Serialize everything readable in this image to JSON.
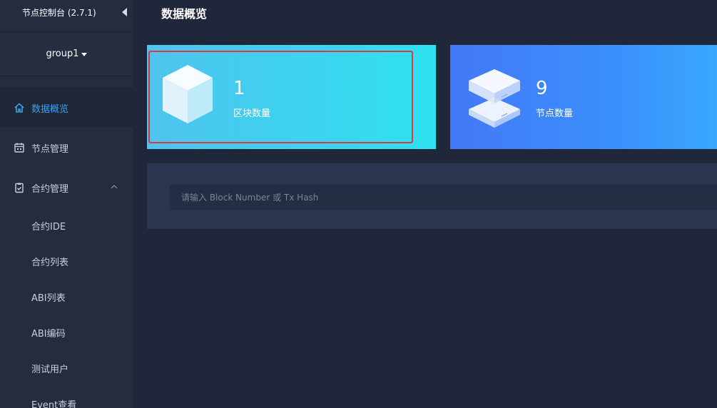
{
  "app": {
    "title": "节点控制台 (2.7.1)"
  },
  "group": {
    "current": "group1"
  },
  "nav": {
    "items": [
      {
        "label": "数据概览"
      },
      {
        "label": "节点管理"
      },
      {
        "label": "合约管理"
      }
    ],
    "contract_sub": [
      {
        "label": "合约IDE"
      },
      {
        "label": "合约列表"
      },
      {
        "label": "ABI列表"
      },
      {
        "label": "ABI编码"
      },
      {
        "label": "测试用户"
      },
      {
        "label": "Event查看"
      }
    ]
  },
  "main": {
    "title": "数据概览",
    "cards": [
      {
        "value": "1",
        "label": "区块数量"
      },
      {
        "value": "9",
        "label": "节点数量"
      }
    ],
    "search": {
      "placeholder": "请输入 Block Number 或 Tx Hash",
      "value": ""
    }
  },
  "colors": {
    "accent": "#37a3f1",
    "highlight": "#e2363a",
    "sidebar_bg": "#242c3e",
    "main_bg": "#20273a"
  }
}
